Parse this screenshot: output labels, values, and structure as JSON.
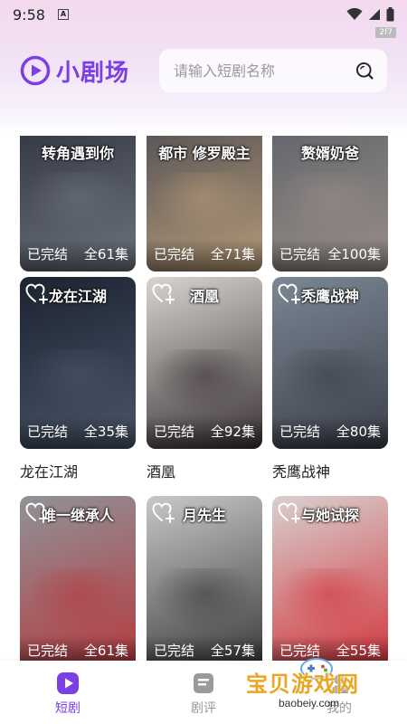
{
  "status_bar": {
    "time": "9:58",
    "notification_letter": "A",
    "fps": "2f7"
  },
  "header": {
    "app_name": "小剧场",
    "search_placeholder": "请输入短剧名称"
  },
  "dramas": [
    {
      "name": "转角遇到你",
      "status": "已完结",
      "episodes": "全61集",
      "poster_title": "转角遇到你",
      "color_a": "#2b2f3a",
      "color_b": "#6d737e",
      "favorite_icon": false
    },
    {
      "name": "都市修罗殿主",
      "status": "已完结",
      "episodes": "全71集",
      "poster_title": "都市 修罗殿主",
      "color_a": "#4a4a52",
      "color_b": "#b59a78",
      "favorite_icon": false
    },
    {
      "name": "赘婿奶爸",
      "status": "已完结",
      "episodes": "全100集",
      "poster_title": "赘婿奶爸",
      "color_a": "#5a6068",
      "color_b": "#9a8e88",
      "favorite_icon": false
    },
    {
      "name": "龙在江湖",
      "status": "已完结",
      "episodes": "全35集",
      "poster_title": "龙在江湖",
      "color_a": "#1c2331",
      "color_b": "#4a5668",
      "favorite_icon": true
    },
    {
      "name": "酒凰",
      "status": "已完结",
      "episodes": "全92集",
      "poster_title": "酒凰",
      "color_a": "#d9d4d2",
      "color_b": "#3a3233",
      "favorite_icon": true
    },
    {
      "name": "秃鹰战神",
      "status": "已完结",
      "episodes": "全80集",
      "poster_title": "秃鹰战神",
      "color_a": "#7b8794",
      "color_b": "#3b3f4a",
      "favorite_icon": true
    },
    {
      "name": "",
      "status": "已完结",
      "episodes": "全61集",
      "poster_title": "唯一继承人",
      "color_a": "#8f9398",
      "color_b": "#b53a3f",
      "favorite_icon": true
    },
    {
      "name": "",
      "status": "已完结",
      "episodes": "全57集",
      "poster_title": "月先生",
      "color_a": "#c9c8c9",
      "color_b": "#3c3a3c",
      "favorite_icon": true
    },
    {
      "name": "",
      "status": "已完结",
      "episodes": "全55集",
      "poster_title": "与她试探",
      "color_a": "#d8d0cf",
      "color_b": "#d2353c",
      "favorite_icon": true
    }
  ],
  "bottom_nav": [
    {
      "label": "短剧",
      "icon": "play-icon",
      "active": true
    },
    {
      "label": "剧评",
      "icon": "review-icon",
      "active": false
    },
    {
      "label": "我的",
      "icon": "profile-icon",
      "active": false
    }
  ],
  "watermark": {
    "text": "宝贝游戏网",
    "url": "baobeiy.com"
  },
  "colors": {
    "brand": "#7b3fe4",
    "inactive": "#999999"
  }
}
